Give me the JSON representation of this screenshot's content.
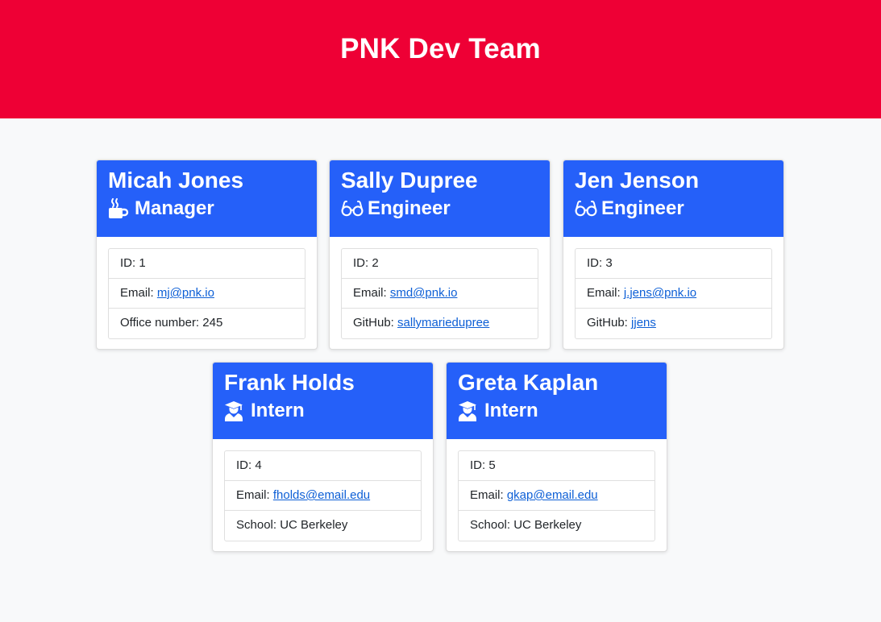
{
  "header": {
    "title": "PNK Dev Team"
  },
  "colors": {
    "header_bg": "#ee0035",
    "card_head_bg": "#2560f9",
    "link": "#0d5fd6"
  },
  "cards": [
    {
      "name": "Micah Jones",
      "role": "Manager",
      "icon": "coffee-icon",
      "id_text": "ID: 1",
      "email_label": "Email: ",
      "email": "mj@pnk.io",
      "extra_label": "Office number: ",
      "extra_value": "245"
    },
    {
      "name": "Sally Dupree",
      "role": "Engineer",
      "icon": "glasses-icon",
      "id_text": "ID: 2",
      "email_label": "Email: ",
      "email": "smd@pnk.io",
      "extra_label": "GitHub: ",
      "extra_value": "sallymariedupree"
    },
    {
      "name": "Jen Jenson",
      "role": "Engineer",
      "icon": "glasses-icon",
      "id_text": "ID: 3",
      "email_label": "Email: ",
      "email": "j.jens@pnk.io",
      "extra_label": "GitHub: ",
      "extra_value": "jjens"
    },
    {
      "name": "Frank Holds",
      "role": "Intern",
      "icon": "graduate-icon",
      "id_text": "ID: 4",
      "email_label": "Email: ",
      "email": "fholds@email.edu",
      "extra_label": "School: ",
      "extra_value": "UC Berkeley"
    },
    {
      "name": "Greta Kaplan",
      "role": "Intern",
      "icon": "graduate-icon",
      "id_text": "ID: 5",
      "email_label": "Email: ",
      "email": "gkap@email.edu",
      "extra_label": "School: ",
      "extra_value": "UC Berkeley"
    }
  ]
}
